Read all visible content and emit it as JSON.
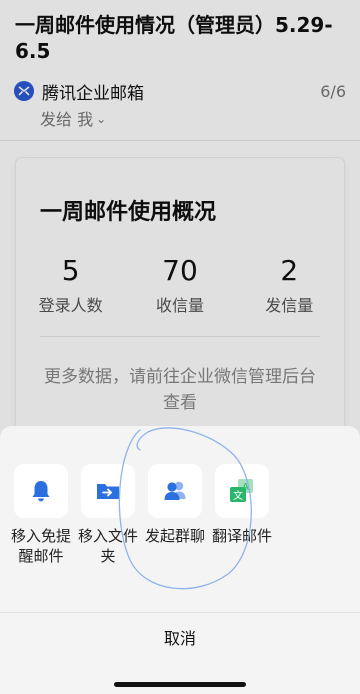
{
  "mail": {
    "title": "一周邮件使用情况（管理员）5.29-6.5",
    "sender": "腾讯企业邮箱",
    "page_count": "6/6",
    "recipient": "发给 我"
  },
  "card": {
    "title": "一周邮件使用概况",
    "stats": [
      {
        "value": "5",
        "label": "登录人数"
      },
      {
        "value": "70",
        "label": "收信量"
      },
      {
        "value": "2",
        "label": "发信量"
      }
    ],
    "note": "更多数据，请前往企业微信管理后台查看"
  },
  "sheet": {
    "actions": [
      {
        "label": "移入免提醒邮件",
        "icon": "bell-icon",
        "color": "#2c6fe0"
      },
      {
        "label": "移入文件夹",
        "icon": "folder-move-icon",
        "color": "#2c6fe0"
      },
      {
        "label": "发起群聊",
        "icon": "group-chat-icon",
        "color": "#2c6fe0"
      },
      {
        "label": "翻译邮件",
        "icon": "translate-icon",
        "color": "#29b66a"
      }
    ],
    "cancel_label": "取消"
  },
  "colors": {
    "accent": "#2c6fe0",
    "sender_logo": "#2c5bd6",
    "annotation": "#8fb4ea"
  }
}
